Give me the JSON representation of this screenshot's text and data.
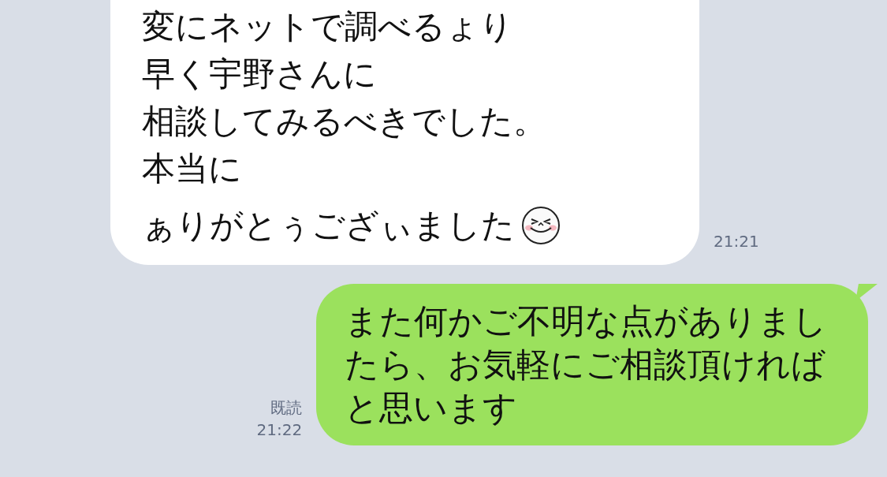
{
  "messages": [
    {
      "kind": "received",
      "lines": [
        "変にネットで調べるょり",
        "早く宇野さんに",
        "相談してみるべきでした。",
        "本当に",
        "ぁりがとぅござぃました"
      ],
      "emoji": true,
      "time": "21:21"
    },
    {
      "kind": "sent",
      "text": "また何かご不明な点がありましたら、お気軽にご相談頂ければと思います",
      "read": "既読",
      "time": "21:22"
    }
  ]
}
